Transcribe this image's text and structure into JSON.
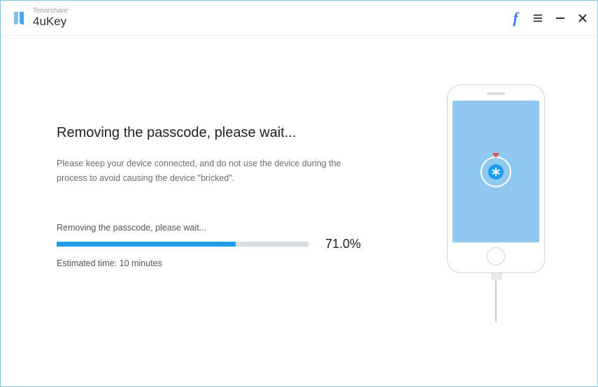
{
  "brand": {
    "company": "Tenorshare",
    "product": "4uKey"
  },
  "colors": {
    "accent": "#1f9cf0",
    "phone_screen": "#8fc9ef",
    "window_border": "#7ec8e3"
  },
  "main": {
    "title": "Removing the passcode, please wait...",
    "description": "Please keep your device connected, and do not use the device during the process to avoid causing the device \"bricked\".",
    "progress_label": "Removing the passcode, please wait...",
    "progress_percent": 71.0,
    "progress_percent_text": "71.0%",
    "estimated_text": "Estimated time: 10 minutes"
  }
}
